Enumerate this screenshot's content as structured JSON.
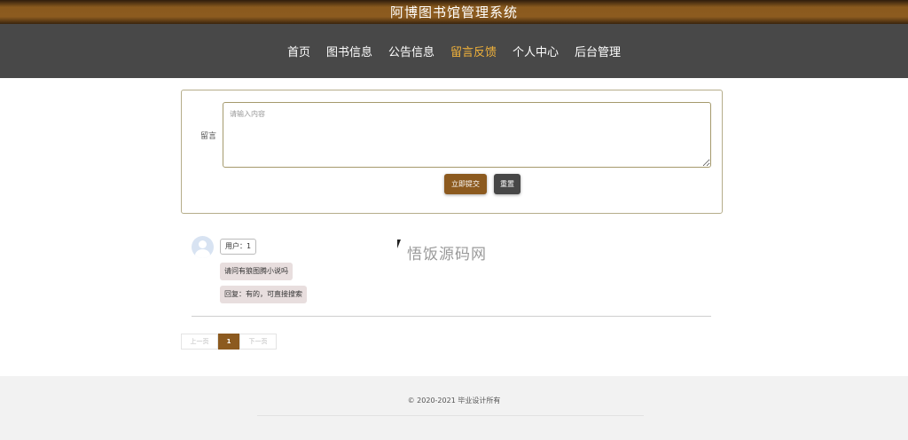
{
  "site": {
    "title": "阿博图书馆管理系统"
  },
  "nav": {
    "items": [
      {
        "label": "首页",
        "active": false
      },
      {
        "label": "图书信息",
        "active": false
      },
      {
        "label": "公告信息",
        "active": false
      },
      {
        "label": "留言反馈",
        "active": true
      },
      {
        "label": "个人中心",
        "active": false
      },
      {
        "label": "后台管理",
        "active": false
      }
    ],
    "active_color": "#f0b13a"
  },
  "form": {
    "label": "留言",
    "placeholder": "请输入内容",
    "value": "",
    "submit_label": "立即提交",
    "reset_label": "重置"
  },
  "comments": [
    {
      "user": "用户：1",
      "content": "请问有狼图腾小说吗",
      "reply": "回复：有的，可直接搜索"
    }
  ],
  "pagination": {
    "prev_label": "上一页",
    "current": "1",
    "next_label": "下一页"
  },
  "watermark": "悟饭源码网",
  "footer": {
    "copyright": "© 2020-2021 毕业设计所有"
  },
  "colors": {
    "brand": "#8c5a1f",
    "nav_bg": "#484848",
    "reset_btn": "#474747"
  }
}
